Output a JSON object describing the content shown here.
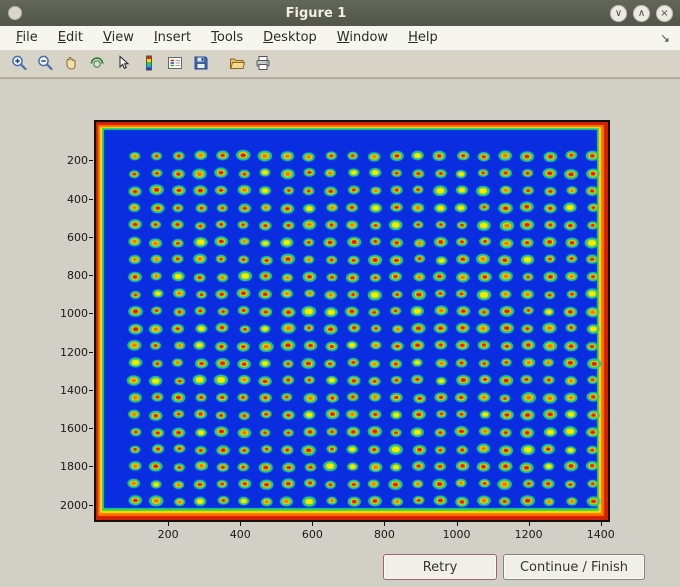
{
  "window": {
    "title": "Figure 1",
    "controls": {
      "minimize_glyph": "∨",
      "maximize_glyph": "∧",
      "close_glyph": "×"
    }
  },
  "menu_bar": {
    "items": [
      {
        "label": "File"
      },
      {
        "label": "Edit"
      },
      {
        "label": "View"
      },
      {
        "label": "Insert"
      },
      {
        "label": "Tools"
      },
      {
        "label": "Desktop"
      },
      {
        "label": "Window"
      },
      {
        "label": "Help"
      }
    ],
    "dock_icon": "↘"
  },
  "toolbar": {
    "icons": [
      "zoom-in-icon",
      "zoom-out-icon",
      "pan-hand-icon",
      "rotate-3d-icon",
      "data-cursor-icon",
      "colorbar-icon",
      "legend-icon",
      "save-icon",
      "open-folder-icon",
      "print-icon"
    ]
  },
  "chart_data": {
    "type": "heatmap",
    "description": "Jet-colormap image (imagesc) of a spotted microarray plate: blue background, ~22x21 grid of hot spots (red cores with yellow/green/cyan rings) and hot red/orange/yellow edges around the plate border",
    "colormap": "jet",
    "x_range": [
      1,
      1420
    ],
    "y_range": [
      1,
      2080
    ],
    "x_ticks": [
      200,
      400,
      600,
      800,
      1000,
      1200,
      1400
    ],
    "y_ticks": [
      200,
      400,
      600,
      800,
      1000,
      1200,
      1400,
      1600,
      1800,
      2000
    ],
    "grid": {
      "cols": 22,
      "rows": 21,
      "x0": 108,
      "dx": 60.5,
      "y0": 178,
      "dy": 90.2
    },
    "colors": {
      "field": "#0b2de0",
      "spot": {
        "outer": "#1fc9c9",
        "ring": "#2fcc33",
        "inner": "#ffe800",
        "core": "#e01500",
        "core_alt": "#ff6a00"
      }
    },
    "edge_bands": [
      {
        "color": "#d42000",
        "l": 2,
        "t": 3,
        "r": 4,
        "b": 4
      },
      {
        "color": "#ff7300",
        "l": 2,
        "t": 2,
        "r": 3,
        "b": 3
      },
      {
        "color": "#ffe000",
        "l": 2,
        "t": 1,
        "r": 2,
        "b": 2
      },
      {
        "color": "#44d622",
        "l": 1,
        "t": 1,
        "r": 1,
        "b": 2
      },
      {
        "color": "#00c8dc",
        "l": 1,
        "t": 1,
        "r": 1,
        "b": 1
      }
    ]
  },
  "action_buttons": {
    "retry": "Retry",
    "continue": "Continue / Finish"
  }
}
